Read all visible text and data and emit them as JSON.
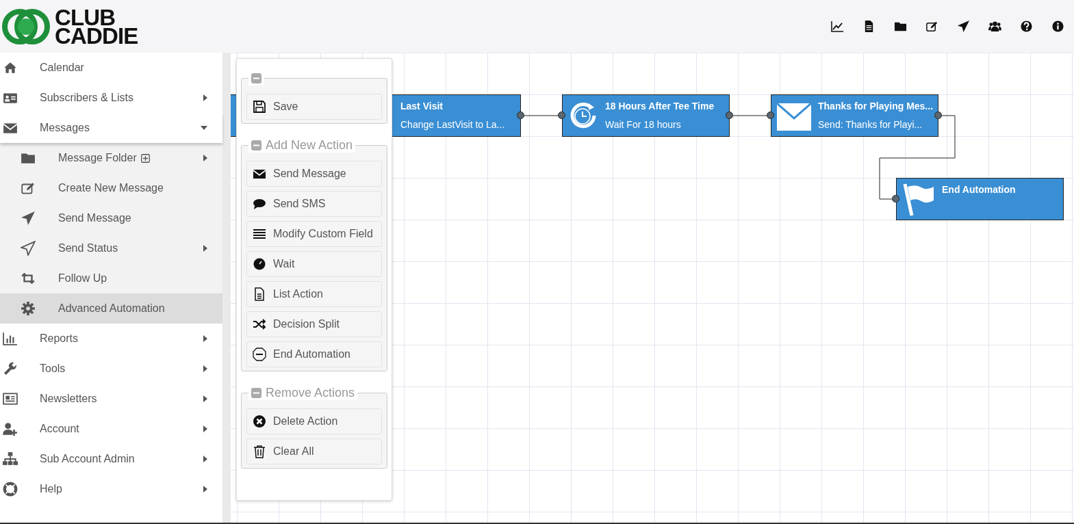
{
  "logo": {
    "line1": "CLUB",
    "line2": "CADDIE"
  },
  "sidebar": {
    "items": [
      {
        "label": "Calendar",
        "has_submenu": false,
        "expanded": false
      },
      {
        "label": "Subscribers & Lists",
        "has_submenu": true,
        "expanded": false
      },
      {
        "label": "Messages",
        "has_submenu": true,
        "expanded": true,
        "children": [
          {
            "label": "Message Folder",
            "has_submenu": true,
            "plus": true,
            "selected": false
          },
          {
            "label": "Create New Message",
            "has_submenu": false,
            "plus": false,
            "selected": false
          },
          {
            "label": "Send Message",
            "has_submenu": false,
            "plus": false,
            "selected": false
          },
          {
            "label": "Send Status",
            "has_submenu": true,
            "plus": false,
            "selected": false
          },
          {
            "label": "Follow Up",
            "has_submenu": false,
            "plus": false,
            "selected": false
          },
          {
            "label": "Advanced Automation",
            "has_submenu": false,
            "plus": false,
            "selected": true
          }
        ]
      },
      {
        "label": "Reports",
        "has_submenu": true,
        "expanded": false
      },
      {
        "label": "Tools",
        "has_submenu": true,
        "expanded": false
      },
      {
        "label": "Newsletters",
        "has_submenu": true,
        "expanded": false
      },
      {
        "label": "Account",
        "has_submenu": true,
        "expanded": false
      },
      {
        "label": "Sub Account Admin",
        "has_submenu": true,
        "expanded": false
      },
      {
        "label": "Help",
        "has_submenu": true,
        "expanded": false
      }
    ]
  },
  "panel": {
    "groups": [
      {
        "buttons": [
          "Save"
        ]
      },
      {
        "title": "Add New Action",
        "buttons": [
          "Send Message",
          "Send SMS",
          "Modify Custom Field",
          "Wait",
          "List Action",
          "Decision Split",
          "End Automation"
        ]
      },
      {
        "title": "Remove Actions",
        "buttons": [
          "Delete Action",
          "Clear All"
        ]
      }
    ]
  },
  "canvas": {
    "nodes": [
      {
        "title": "Last Visit",
        "subtitle": "Change LastVisit to La..."
      },
      {
        "title": "18 Hours After Tee Time",
        "subtitle": "Wait For 18 hours"
      },
      {
        "title": "Thanks for Playing Mes...",
        "subtitle": "Send: Thanks for Playi..."
      },
      {
        "title": "End Automation"
      }
    ]
  }
}
